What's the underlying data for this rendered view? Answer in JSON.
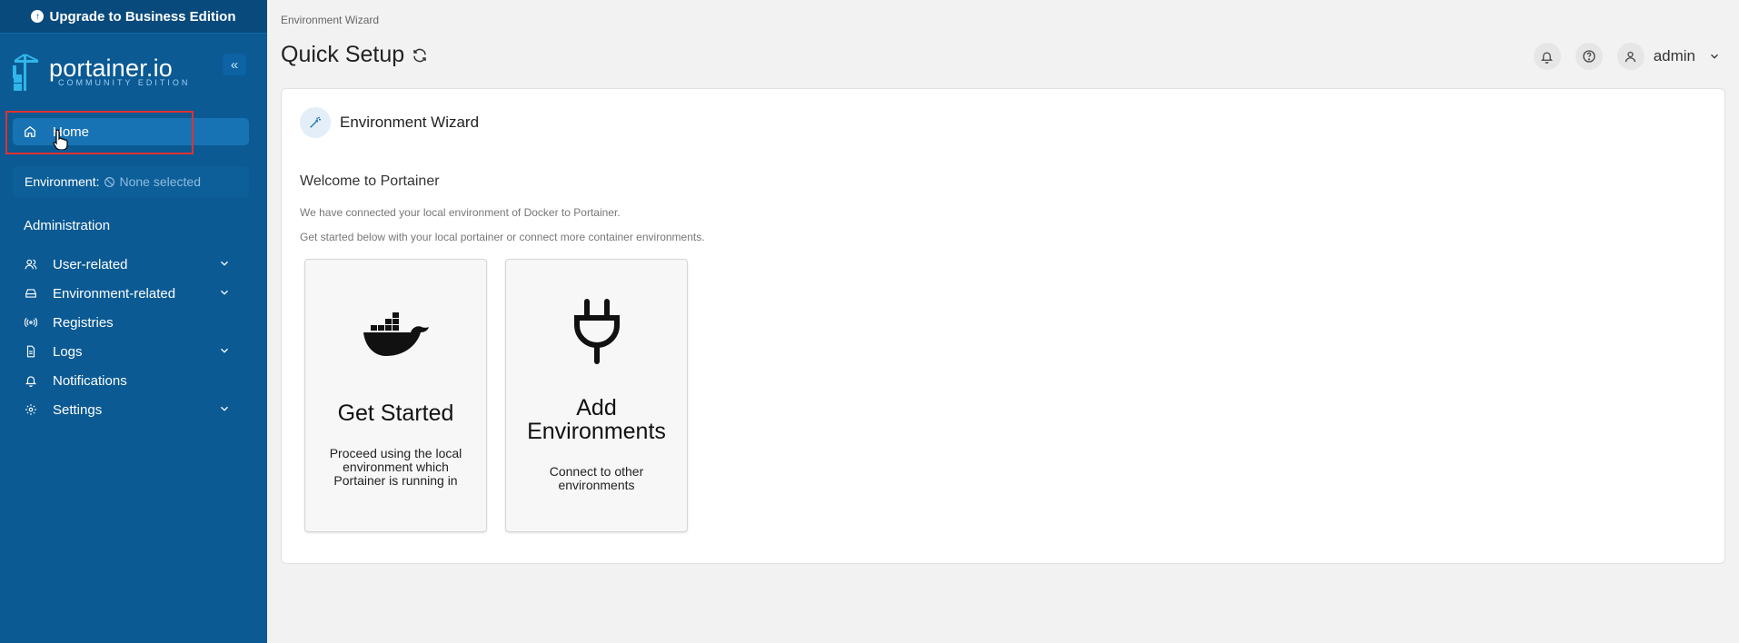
{
  "sidebar": {
    "upgrade_label": "Upgrade to Business Edition",
    "logo_text": "portainer.io",
    "logo_subtitle": "COMMUNITY EDITION",
    "collapse_symbol": "«",
    "home_label": "Home",
    "environment_label": "Environment:",
    "environment_value": "None selected",
    "section_title": "Administration",
    "menu": [
      {
        "label": "User-related",
        "icon": "users-icon",
        "expandable": true
      },
      {
        "label": "Environment-related",
        "icon": "hard-drive-icon",
        "expandable": true
      },
      {
        "label": "Registries",
        "icon": "radio-icon",
        "expandable": false
      },
      {
        "label": "Logs",
        "icon": "file-text-icon",
        "expandable": true
      },
      {
        "label": "Notifications",
        "icon": "bell-icon",
        "expandable": false
      },
      {
        "label": "Settings",
        "icon": "gear-icon",
        "expandable": true
      }
    ]
  },
  "header": {
    "breadcrumb": "Environment Wizard",
    "title": "Quick Setup",
    "user": "admin"
  },
  "wizard": {
    "title": "Environment Wizard",
    "welcome": "Welcome to Portainer",
    "desc1": "We have connected your local environment of Docker to Portainer.",
    "desc2": "Get started below with your local portainer or connect more container environments.",
    "cards": [
      {
        "title": "Get Started",
        "desc": "Proceed using the local environment which Portainer is running in",
        "icon": "docker-whale-icon"
      },
      {
        "title": "Add Environments",
        "desc": "Connect to other environments",
        "icon": "plug-icon"
      }
    ]
  },
  "colors": {
    "sidebar_bg": "#0b5a94",
    "upgrade_bg": "#084a7c",
    "active_item": "#1873b4",
    "highlight_border": "#e03131"
  }
}
